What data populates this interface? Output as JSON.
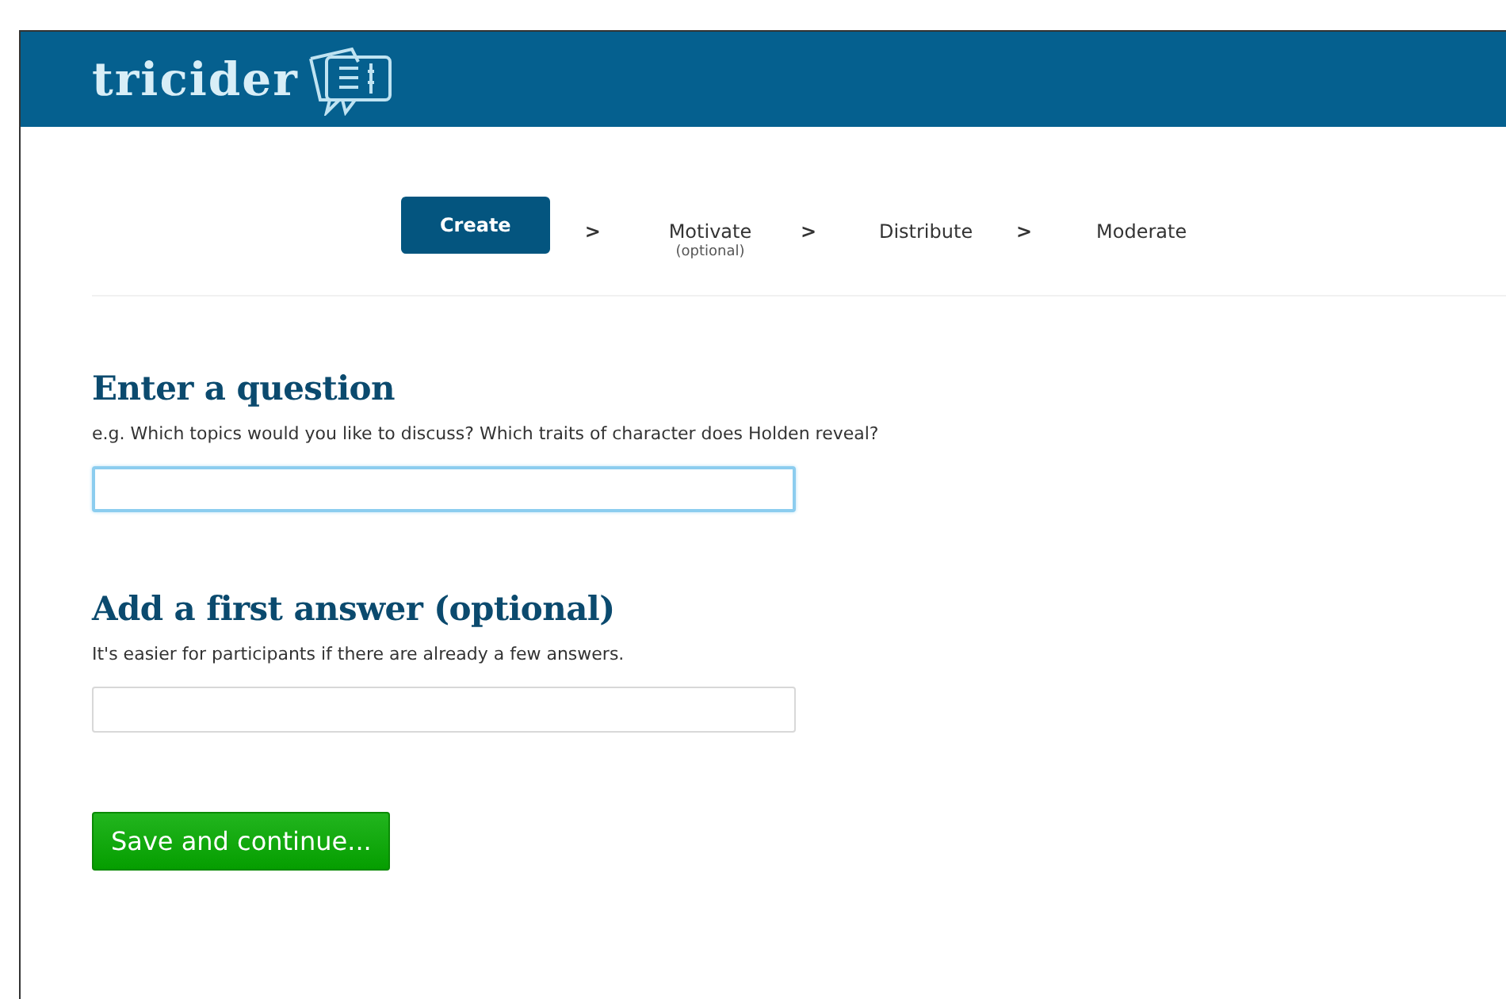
{
  "header": {
    "logo": "tricider"
  },
  "steps": [
    {
      "label": "Create",
      "selected": true,
      "separator": ">"
    },
    {
      "label": "Motivate",
      "note": "(optional)",
      "selected": false,
      "separator": ">"
    },
    {
      "label": "Distribute",
      "selected": false,
      "separator": ">"
    },
    {
      "label": "Moderate",
      "selected": false
    }
  ],
  "sections": [
    {
      "heading": "Enter a question",
      "hint": "e.g. Which topics would you like to discuss? Which traits of character does Holden reveal?",
      "focused": true
    },
    {
      "heading": "Add a first answer (optional)",
      "hint": "It's easier for participants if there are already a few answers.",
      "focused": false
    }
  ],
  "submit": {
    "label": "Save and continue..."
  }
}
